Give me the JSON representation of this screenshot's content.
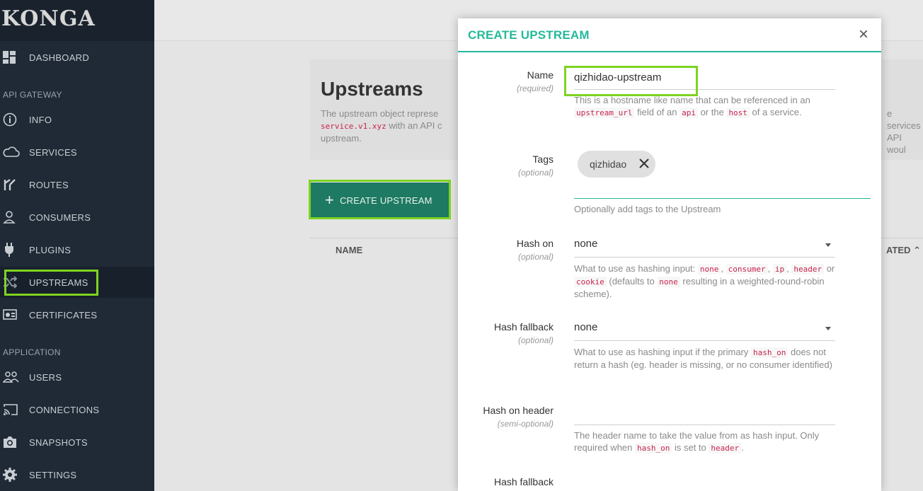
{
  "sidebar": {
    "logo": "KONGA",
    "dashboard": "DASHBOARD",
    "section_api": "API GATEWAY",
    "items_api": [
      "INFO",
      "SERVICES",
      "ROUTES",
      "CONSUMERS",
      "PLUGINS",
      "UPSTREAMS",
      "CERTIFICATES"
    ],
    "section_app": "APPLICATION",
    "items_app": [
      "USERS",
      "CONNECTIONS",
      "SNAPSHOTS",
      "SETTINGS"
    ]
  },
  "main": {
    "title": "Upstreams",
    "desc_left": "The upstream object represe",
    "desc_code": "service.v1.xyz",
    "desc_mid": " with an API c",
    "desc_end": "upstream.",
    "desc_right_1": "e services",
    "desc_right_2": "API woul",
    "create_button": "CREATE UPSTREAM",
    "col_name": "NAME",
    "col_created": "ATED"
  },
  "modal": {
    "title": "CREATE UPSTREAM",
    "close": "×",
    "name_label": "Name",
    "name_sub": "(required)",
    "name_value": "qizhidao-upstream",
    "name_help": {
      "t1": "This is a hostname like name that can be referenced in an ",
      "c1": "upstream_url",
      "t2": " field of an ",
      "c2": "api",
      "t3": " or the ",
      "c3": "host",
      "t4": " of a service."
    },
    "tags_label": "Tags",
    "tags_sub": "(optional)",
    "tag_chip": "qizhidao",
    "tags_help": "Optionally add tags to the Upstream",
    "hash_on_label": "Hash on",
    "hash_on_sub": "(optional)",
    "hash_on_value": "none",
    "hash_on_help": {
      "t1": "What to use as hashing input: ",
      "c1": "none",
      "t2": ", ",
      "c2": "consumer",
      "t3": ", ",
      "c3": "ip",
      "t4": ", ",
      "c4": "header",
      "t5": " or ",
      "c5": "cookie",
      "t6": " (defaults to ",
      "c6": "none",
      "t7": " resulting in a weighted-round-robin scheme)."
    },
    "hash_fallback_label": "Hash fallback",
    "hash_fallback_sub": "(optional)",
    "hash_fallback_value": "none",
    "hash_fallback_help": {
      "t1": "What to use as hashing input if the primary ",
      "c1": "hash_on",
      "t2": " does not return a hash (eg. header is missing, or no consumer identified)"
    },
    "hash_header_label": "Hash on header",
    "hash_header_sub": "(semi-optional)",
    "hash_header_help": {
      "t1": "The header name to take the value from as hash input. Only required when ",
      "c1": "hash_on",
      "t2": " is set to ",
      "c2": "header",
      "t3": "."
    },
    "hash_fallback_header_label": "Hash fallback"
  },
  "colors": {
    "accent": "#26b99a",
    "button": "#1e7a62",
    "highlight": "#7ed321",
    "sidebar": "#1f2a36"
  }
}
